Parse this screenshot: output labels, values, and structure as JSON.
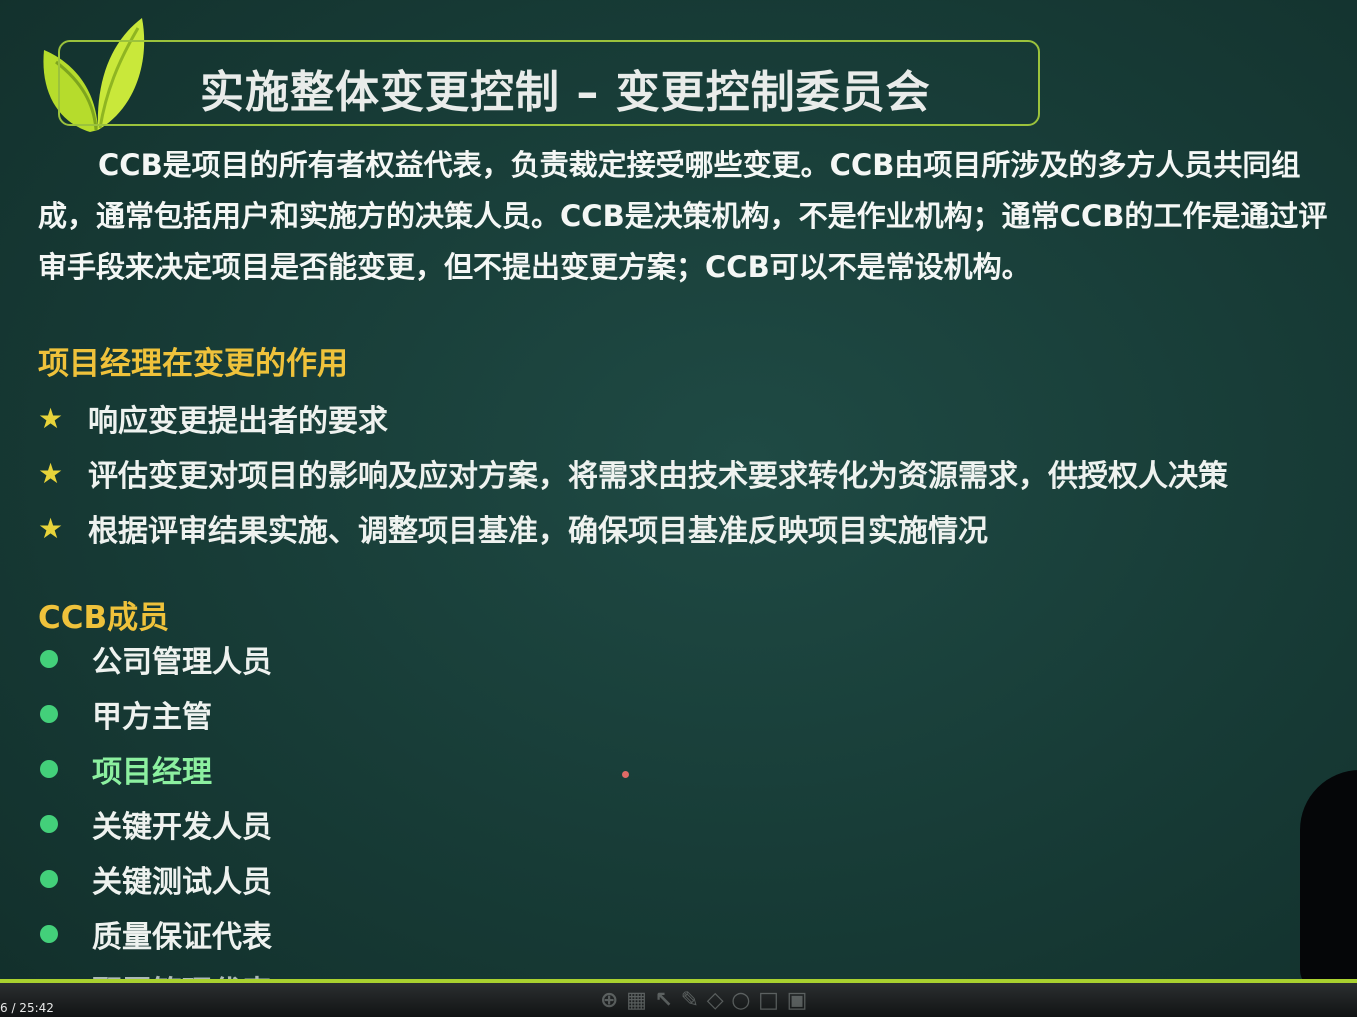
{
  "slide": {
    "title": "实施整体变更控制 – 变更控制委员会",
    "intro": "CCB是项目的所有者权益代表，负责裁定接受哪些变更。CCB由项目所涉及的多方人员共同组成，通常包括用户和实施方的决策人员。CCB是决策机构，不是作业机构；通常CCB的工作是通过评审手段来决定项目是否能变更，但不提出变更方案；CCB可以不是常设机构。",
    "pm_role": {
      "heading": "项目经理在变更的作用",
      "items": [
        "响应变更提出者的要求",
        "评估变更对项目的影响及应对方案，将需求由技术要求转化为资源需求，供授权人决策",
        "根据评审结果实施、调整项目基准，确保项目基准反映项目实施情况"
      ]
    },
    "ccb_members": {
      "heading": "CCB成员",
      "items": [
        "公司管理人员",
        "甲方主管",
        "项目经理",
        "关键开发人员",
        "关键测试人员",
        "质量保证代表",
        "配置管理代表"
      ]
    }
  },
  "player": {
    "time": "6 / 25:42",
    "accent_color": "#a9d12f"
  },
  "icons": {
    "logo": "leaf-logo-icon",
    "bullet_star": "star-icon",
    "bullet_dot": "green-dot-icon"
  }
}
